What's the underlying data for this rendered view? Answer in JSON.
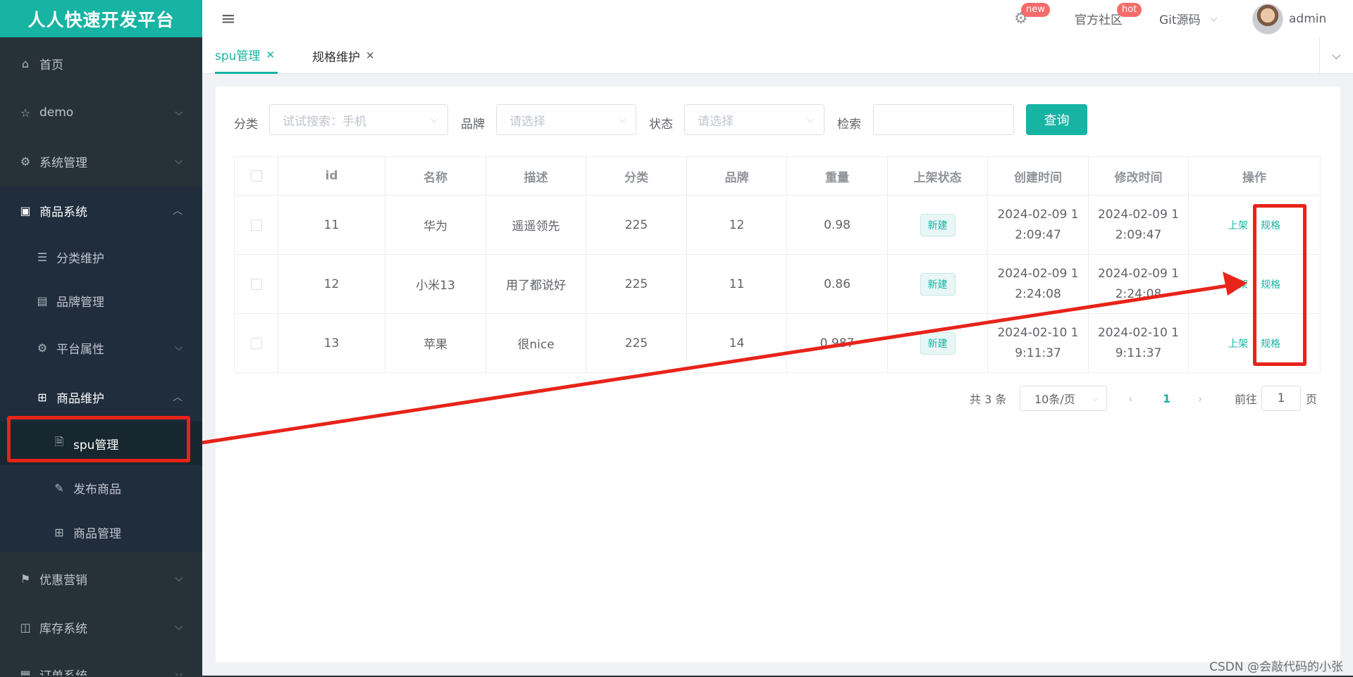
{
  "app": {
    "title": "人人快速开发平台"
  },
  "sidebar": {
    "items": [
      {
        "label": "首页"
      },
      {
        "label": "demo"
      },
      {
        "label": "系统管理"
      },
      {
        "label": "商品系统"
      },
      {
        "label": "分类维护"
      },
      {
        "label": "品牌管理"
      },
      {
        "label": "平台属性"
      },
      {
        "label": "商品维护"
      },
      {
        "label": "spu管理"
      },
      {
        "label": "发布商品"
      },
      {
        "label": "商品管理"
      },
      {
        "label": "优惠营销"
      },
      {
        "label": "库存系统"
      },
      {
        "label": "订单系统"
      }
    ]
  },
  "header": {
    "badge_new": "new",
    "community": "官方社区",
    "badge_hot": "hot",
    "git": "Git源码",
    "user": "admin"
  },
  "tabs": [
    {
      "label": "spu管理"
    },
    {
      "label": "规格维护"
    }
  ],
  "filters": {
    "category_label": "分类",
    "category_placeholder": "试试搜索：手机",
    "brand_label": "品牌",
    "brand_placeholder": "请选择",
    "status_label": "状态",
    "status_placeholder": "请选择",
    "search_label": "检索",
    "search_value": "",
    "query_button": "查询"
  },
  "table": {
    "headers": [
      "id",
      "名称",
      "描述",
      "分类",
      "品牌",
      "重量",
      "上架状态",
      "创建时间",
      "修改时间",
      "操作"
    ],
    "rows": [
      {
        "id": "11",
        "name": "华为",
        "desc": "遥遥领先",
        "category": "225",
        "brand": "12",
        "weight": "0.98",
        "status": "新建",
        "created_1": "2024-02-09 1",
        "created_2": "2:09:47",
        "modified_1": "2024-02-09 1",
        "modified_2": "2:09:47",
        "action_up": "上架",
        "action_spec": "规格"
      },
      {
        "id": "12",
        "name": "小米13",
        "desc": "用了都说好",
        "category": "225",
        "brand": "11",
        "weight": "0.86",
        "status": "新建",
        "created_1": "2024-02-09 1",
        "created_2": "2:24:08",
        "modified_1": "2024-02-09 1",
        "modified_2": "2:24:08",
        "action_up": "上架",
        "action_spec": "规格"
      },
      {
        "id": "13",
        "name": "苹果",
        "desc": "很nice",
        "category": "225",
        "brand": "14",
        "weight": "0.987",
        "status": "新建",
        "created_1": "2024-02-10 1",
        "created_2": "9:11:37",
        "modified_1": "2024-02-10 1",
        "modified_2": "9:11:37",
        "action_up": "上架",
        "action_spec": "规格"
      }
    ]
  },
  "pagination": {
    "total": "共 3 条",
    "page_size": "10条/页",
    "current": "1",
    "goto_prefix": "前往",
    "goto_value": "1",
    "goto_suffix": "页"
  },
  "watermark": "CSDN @会敲代码的小张",
  "colors": {
    "accent": "#17b3a3",
    "sidebar": "#263238",
    "annotation": "#e8231a"
  }
}
